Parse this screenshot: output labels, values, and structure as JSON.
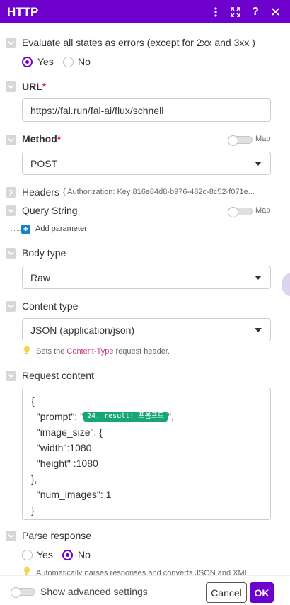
{
  "header": {
    "title": "HTTP"
  },
  "evaluate": {
    "label": "Evaluate all states as errors (except for 2xx and 3xx )",
    "yes": "Yes",
    "no": "No"
  },
  "url": {
    "label": "URL",
    "required": "*",
    "value": "https://fal.run/fal-ai/flux/schnell"
  },
  "method": {
    "label": "Method",
    "required": "*",
    "map_label": "Map",
    "value": "POST"
  },
  "headers": {
    "label": "Headers",
    "summary": "{ Authorization: Key 816e84d8-b976-482c-8c52-f071e..."
  },
  "query_string": {
    "label": "Query String",
    "map_label": "Map",
    "add_parameter": "Add parameter"
  },
  "body_type": {
    "label": "Body type",
    "value": "Raw"
  },
  "content_type": {
    "label": "Content type",
    "value": "JSON (application/json)",
    "hint_pre": "Sets the ",
    "hint_kw": "Content-Type",
    "hint_post": " request header."
  },
  "request_content": {
    "label": "Request content",
    "lines": {
      "l1": "{",
      "l2_pre": "  \"prompt\": \"",
      "l2_pill": "24. result: 프롬프트",
      "l2_post": "\",",
      "l3": "  \"image_size\": {",
      "l4": "  \"width\":1080,",
      "l5": "  \"height\" :1080",
      "l6": "},",
      "l7": "  \"num_images\": 1",
      "l8": "}"
    }
  },
  "parse_response": {
    "label": "Parse response",
    "yes": "Yes",
    "no": "No",
    "hint": "Automatically parses responses and converts JSON and XML"
  },
  "footer": {
    "advanced": "Show advanced settings",
    "cancel": "Cancel",
    "ok": "OK"
  },
  "colors": {
    "brand": "#6d00cc",
    "pill": "#17a678",
    "required": "#e0245e"
  }
}
